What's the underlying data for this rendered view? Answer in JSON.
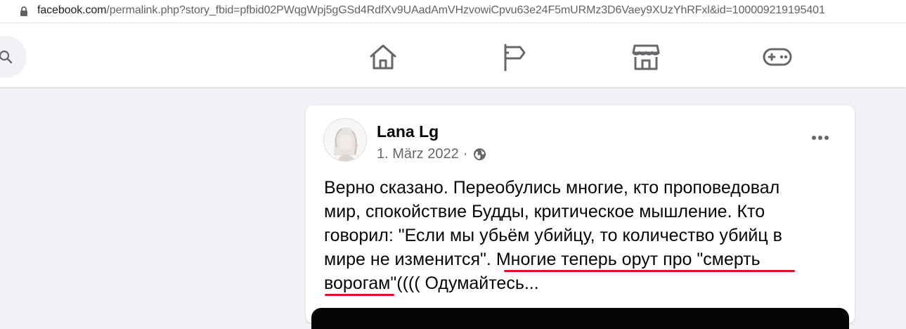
{
  "browser": {
    "url_host": "facebook.com",
    "url_rest": "/permalink.php?story_fbid=pfbid02PWqgWpj5gGSd4RdfXv9UAadAmVHzvowiCpvu63e24F5mURMz3D6Vaey9XUzYhRFxl&id=100009219195401",
    "lock_icon": "lock-icon"
  },
  "nav": {
    "search_icon": "search-icon",
    "icons": [
      "home-icon",
      "flag-icon",
      "marketplace-icon",
      "gaming-icon"
    ]
  },
  "post": {
    "author": "Lana Lg",
    "date": "1. März 2022",
    "separator": "·",
    "privacy_icon": "globe-icon",
    "more_icon": "more-options-icon",
    "text_lines": [
      "Верно сказано. Переобулись многие, кто проповедовал",
      "мир, спокойствие Будды, критическое мышление. Кто",
      "говорил: \"Если мы убьём убийцу, то количество убийц в",
      "мире не изменится\". Многие теперь орут про \"смерть",
      "ворогам\"(((( Одумайтесь..."
    ]
  },
  "colors": {
    "background": "#f0f2f5",
    "card": "#ffffff",
    "secondary_text": "#65676b",
    "annotation_underline": "#e0102a"
  }
}
